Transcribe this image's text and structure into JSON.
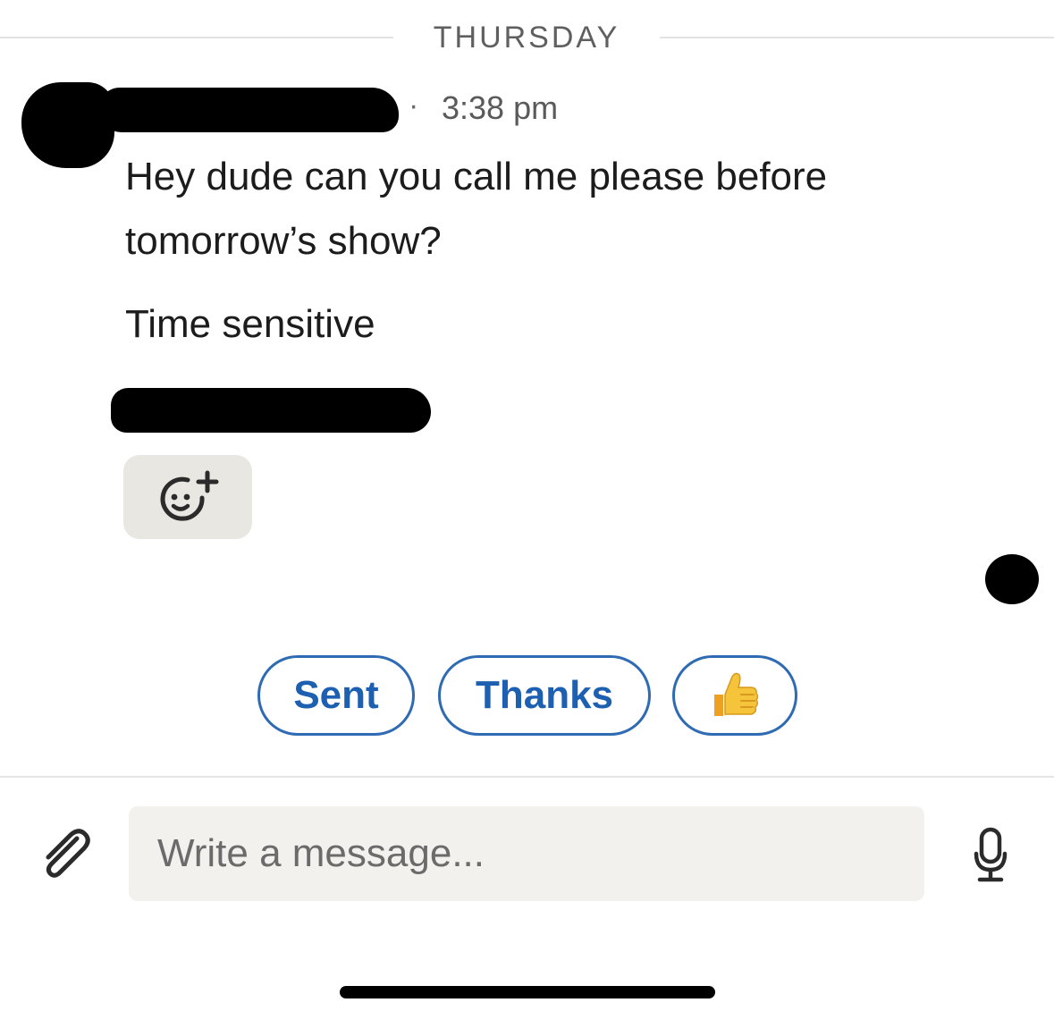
{
  "divider": {
    "day": "THURSDAY"
  },
  "message": {
    "separator": "·",
    "time": "3:38 pm",
    "lines": [
      "Hey dude can you call me please before",
      "tomorrow’s show?",
      "Time sensitive"
    ]
  },
  "reaction_button": {
    "icon": "add-reaction-icon"
  },
  "quick_replies": [
    {
      "label": "Sent"
    },
    {
      "label": "Thanks"
    },
    {
      "label": "👍",
      "icon": "thumbs-up-emoji"
    }
  ],
  "composer": {
    "placeholder": "Write a message...",
    "value": "",
    "attach_icon": "paperclip-icon",
    "mic_icon": "microphone-icon"
  },
  "colors": {
    "accent": "#1d5fb0",
    "chip_border": "#2f6bb3",
    "reaction_bg": "#e9e7e2",
    "input_bg": "#f2f1ee"
  }
}
